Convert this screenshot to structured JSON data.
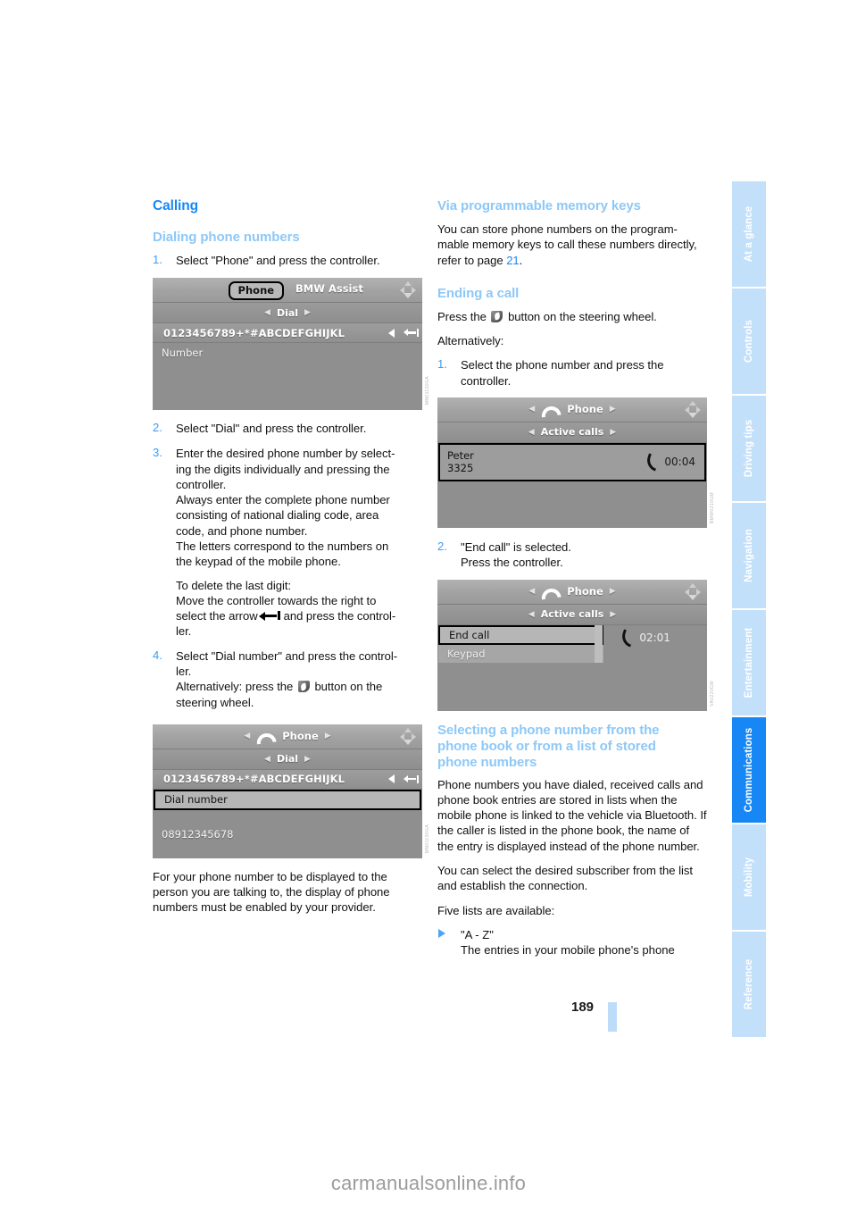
{
  "page": {
    "number": "189",
    "watermark": "carmanualsonline.info"
  },
  "sidebar": {
    "tabs": [
      {
        "label": "At a glance",
        "active": false
      },
      {
        "label": "Controls",
        "active": false
      },
      {
        "label": "Driving tips",
        "active": false
      },
      {
        "label": "Navigation",
        "active": false
      },
      {
        "label": "Entertainment",
        "active": false
      },
      {
        "label": "Communications",
        "active": true
      },
      {
        "label": "Mobility",
        "active": false
      },
      {
        "label": "Reference",
        "active": false
      }
    ],
    "active_color": "#1787f5",
    "inactive_color": "#c3e0fb"
  },
  "left_column": {
    "heading": "Calling",
    "subheading": "Dialing phone numbers",
    "step1": {
      "num": "1.",
      "text": "Select \"Phone\" and press the controller."
    },
    "screenshot1": {
      "code": "MN01130GA",
      "tab_selected": "Phone",
      "tab_other": "BMW Assist",
      "row_label": "Dial",
      "keys": "0123456789+*#ABCDEFGHIJKL",
      "list_item": "Number"
    },
    "step2": {
      "num": "2.",
      "text": "Select \"Dial\" and press the controller."
    },
    "step3": {
      "num": "3.",
      "line1": "Enter the desired phone number by select-",
      "line2": "ing the digits individually and pressing the",
      "line3": "controller.",
      "para2_line1": "Always enter the complete phone number",
      "para2_line2": "consisting of national dialing code, area",
      "para2_line3": "code, and phone number.",
      "para3_line1": "The letters correspond to the numbers on",
      "para3_line2": "the keypad of the mobile phone.",
      "para4_line1": "To delete the last digit:",
      "para4_line2": "Move the controller towards the right to",
      "para4_line3_a": "select the arrow",
      "para4_line3_b": "and press the control-",
      "para4_line4": "ler."
    },
    "step4": {
      "num": "4.",
      "line1": "Select \"Dial number\" and press the control-",
      "line2": "ler.",
      "line3_a": "Alternatively: press the",
      "line3_b": "button on the",
      "line4": "steering wheel."
    },
    "screenshot2": {
      "code": "MN01130GA",
      "title": "Phone",
      "row_label": "Dial",
      "keys": "0123456789+*#ABCDEFGHIJKL",
      "selected_item": "Dial number",
      "number": "08912345678"
    },
    "closing": {
      "line1": "For your phone number to be displayed to the",
      "line2": "person you are talking to, the display of phone",
      "line3": "numbers must be enabled by your provider."
    }
  },
  "right_column": {
    "memory_keys": {
      "heading": "Via programmable memory keys",
      "line1": "You can store phone numbers on the program-",
      "line2": "mable memory keys to call these numbers",
      "line3_a": "directly, refer to page",
      "page_ref": "21",
      "line3_b": "."
    },
    "ending_call": {
      "heading": "Ending a call",
      "press_a": "Press the",
      "press_b": "button on the steering wheel.",
      "alternatively": "Alternatively:",
      "step1": {
        "num": "1.",
        "line1": "Select the phone number and press the",
        "line2": "controller."
      },
      "screenshot1": {
        "code": "BMW0210GM",
        "title": "Phone",
        "row_label": "Active calls",
        "caller_name": "Peter",
        "caller_number": "3325",
        "duration": "00:04"
      },
      "step2": {
        "num": "2.",
        "line1": "\"End call\" is selected.",
        "line2": "Press the controller."
      },
      "screenshot2": {
        "code": "VA0220GM",
        "title": "Phone",
        "row_label": "Active calls",
        "item_selected": "End call",
        "item_second": "Keypad",
        "duration": "02:01"
      }
    },
    "phone_book": {
      "heading_line1": "Selecting a phone number from the",
      "heading_line2": "phone book or from a list of stored",
      "heading_line3": "phone numbers",
      "p1_line1": "Phone numbers you have dialed, received calls",
      "p1_line2": "and phone book entries are stored in lists when",
      "p1_line3": "the mobile phone is linked to the vehicle via",
      "p1_line4": "Bluetooth. If the caller is listed in the phone",
      "p1_line5": "book, the name of the entry is displayed instead",
      "p1_line6": "of the phone number.",
      "p2_line1": "You can select the desired subscriber from the",
      "p2_line2": "list and establish the connection.",
      "p3": "Five lists are available:",
      "bullet1_label": "\"A - Z\"",
      "bullet1_text": "The entries in your mobile phone's phone"
    }
  }
}
